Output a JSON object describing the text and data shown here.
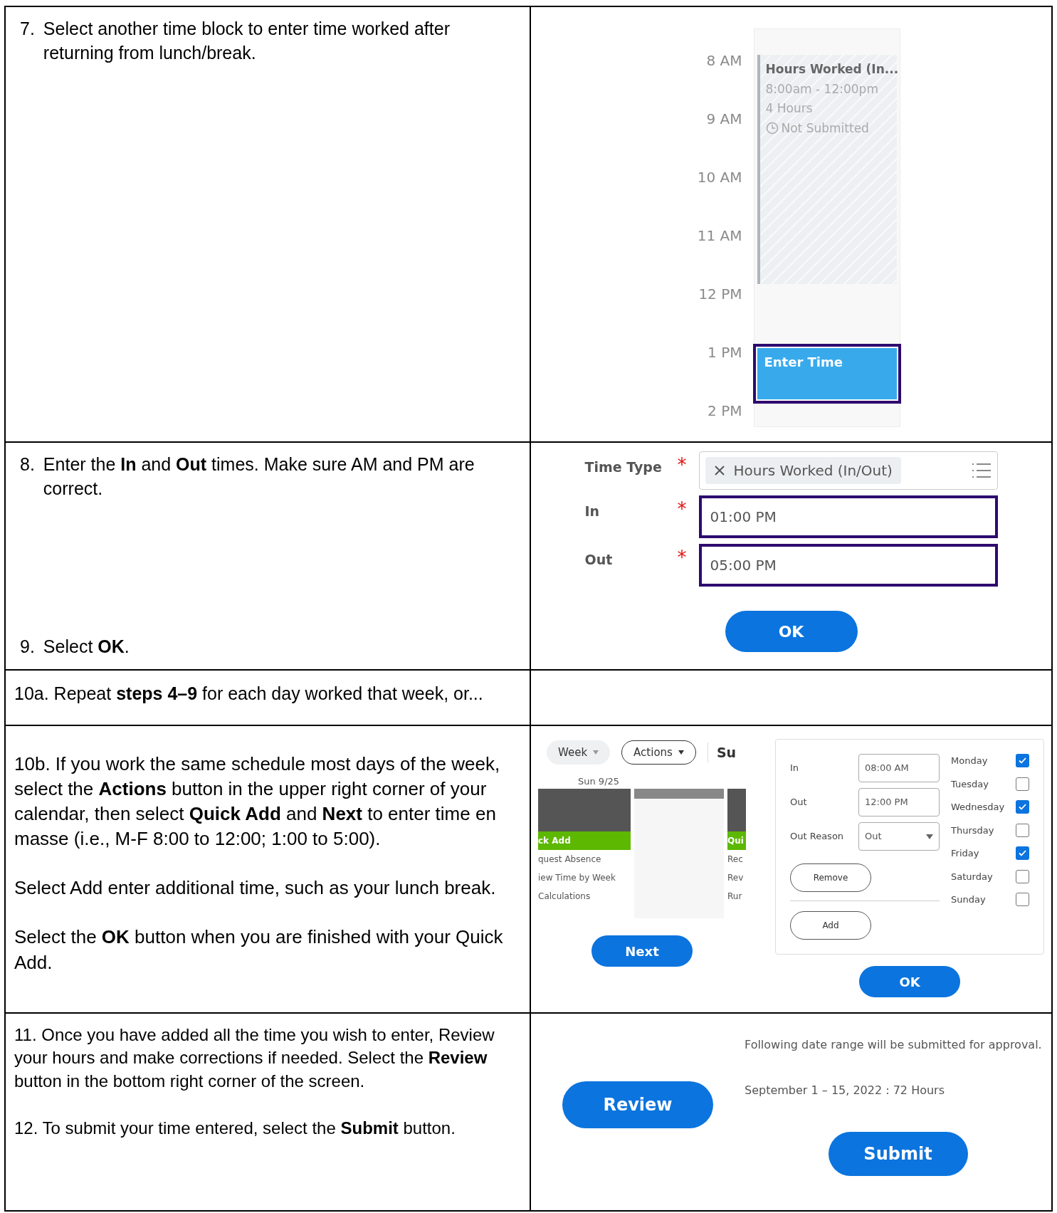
{
  "row_7": {
    "steps": [
      {
        "number": "7.",
        "text": "Select another time block to enter time worked after returning from lunch/break."
      }
    ],
    "calendar": {
      "hours": [
        "8 AM",
        "9 AM",
        "10 AM",
        "11 AM",
        "12 PM",
        "1 PM",
        "2 PM"
      ],
      "event": {
        "title": "Hours Worked (In...",
        "time": "8:00am - 12:00pm",
        "duration": "4 Hours",
        "status": "Not Submitted"
      },
      "new_block": {
        "label": "Enter Time",
        "highlighted": true
      }
    }
  },
  "row_8": {
    "steps": [
      {
        "number": "8.",
        "text": "Enter the **In** and **Out** times. Make sure AM and PM are correct."
      },
      {
        "number": "9.",
        "text": "Select **OK**."
      }
    ],
    "form": {
      "fields": [
        {
          "kind": "chip",
          "label": "Time Type",
          "required_mark": "*",
          "value": "Hours Worked (In/Out)",
          "highlighted": false
        },
        {
          "kind": "text",
          "label": "In",
          "required_mark": "*",
          "value": "01:00 PM",
          "highlighted": true
        },
        {
          "kind": "text",
          "label": "Out",
          "required_mark": "*",
          "value": "05:00 PM",
          "highlighted": true
        }
      ],
      "ok_button": "OK"
    }
  },
  "row_10a": {
    "text": "10a. Repeat **steps 4–9** for each day worked that week, or..."
  },
  "row_10b": {
    "paragraphs": [
      "10b. If you work the same schedule most days of the week, select the **Actions** button in the upper right corner of your calendar, then select **Quick Add** and **Next** to enter time en masse (i.e., M-F 8:00 to 12:00; 1:00 to 5:00).",
      "Select Add enter additional time, such as your lunch break.",
      "Select the **OK** button when you are finished with your Quick Add."
    ],
    "actions_screenshot": {
      "week_button": "Week",
      "actions_button": "Actions",
      "heading": "Su",
      "date": "Sun 9/25",
      "menu_left": [
        {
          "label": "ck Add",
          "selected": true
        },
        {
          "label": "quest Absence",
          "selected": false
        },
        {
          "label": "iew Time by Week",
          "selected": false
        },
        {
          "label": "Calculations",
          "selected": false
        }
      ],
      "menu_right": [
        {
          "label": "Qui",
          "selected": true
        },
        {
          "label": "Rec",
          "selected": false
        },
        {
          "label": "Rev",
          "selected": false
        },
        {
          "label": "Rur",
          "selected": false
        }
      ],
      "next_button": "Next"
    },
    "quick_add": {
      "in_label": "In",
      "in_value": "08:00 AM",
      "out_label": "Out",
      "out_value": "12:00 PM",
      "reason_label": "Out Reason",
      "reason_value": "Out",
      "remove_button": "Remove",
      "add_button": "Add",
      "days": [
        {
          "label": "Monday",
          "checked": true
        },
        {
          "label": "Tuesday",
          "checked": false
        },
        {
          "label": "Wednesday",
          "checked": true
        },
        {
          "label": "Thursday",
          "checked": false
        },
        {
          "label": "Friday",
          "checked": true
        },
        {
          "label": "Saturday",
          "checked": false
        },
        {
          "label": "Sunday",
          "checked": false
        }
      ],
      "ok_button": "OK"
    }
  },
  "row_11": {
    "paragraphs": [
      "11. Once you have added all the time you wish to enter, Review your hours and make corrections if needed. Select the **Review** button in the bottom right corner of the screen.",
      "12. To submit your time entered, select the **Submit** button."
    ],
    "review_button": "Review",
    "submit_panel": {
      "message": "Following date range will be submitted for approval.",
      "range": "September 1 – 15, 2022 : 72 Hours",
      "submit_button": "Submit"
    }
  }
}
